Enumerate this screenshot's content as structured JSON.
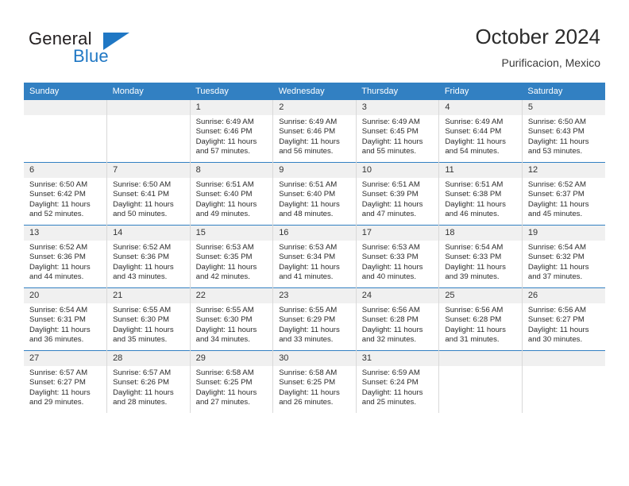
{
  "logo": {
    "word_one": "General",
    "word_two": "Blue",
    "triangle_color": "#1f77c4"
  },
  "header": {
    "title": "October 2024",
    "subtitle": "Purificacion, Mexico",
    "accent_color": "#3280c2",
    "daynum_band_color": "#f0f0f0"
  },
  "weekdays": [
    "Sunday",
    "Monday",
    "Tuesday",
    "Wednesday",
    "Thursday",
    "Friday",
    "Saturday"
  ],
  "weeks": [
    [
      {
        "day": "",
        "sunrise": "",
        "sunset": "",
        "daylight_line1": "",
        "daylight_line2": "",
        "empty": true
      },
      {
        "day": "",
        "sunrise": "",
        "sunset": "",
        "daylight_line1": "",
        "daylight_line2": "",
        "empty": true
      },
      {
        "day": "1",
        "sunrise": "Sunrise: 6:49 AM",
        "sunset": "Sunset: 6:46 PM",
        "daylight_line1": "Daylight: 11 hours",
        "daylight_line2": "and 57 minutes."
      },
      {
        "day": "2",
        "sunrise": "Sunrise: 6:49 AM",
        "sunset": "Sunset: 6:46 PM",
        "daylight_line1": "Daylight: 11 hours",
        "daylight_line2": "and 56 minutes."
      },
      {
        "day": "3",
        "sunrise": "Sunrise: 6:49 AM",
        "sunset": "Sunset: 6:45 PM",
        "daylight_line1": "Daylight: 11 hours",
        "daylight_line2": "and 55 minutes."
      },
      {
        "day": "4",
        "sunrise": "Sunrise: 6:49 AM",
        "sunset": "Sunset: 6:44 PM",
        "daylight_line1": "Daylight: 11 hours",
        "daylight_line2": "and 54 minutes."
      },
      {
        "day": "5",
        "sunrise": "Sunrise: 6:50 AM",
        "sunset": "Sunset: 6:43 PM",
        "daylight_line1": "Daylight: 11 hours",
        "daylight_line2": "and 53 minutes."
      }
    ],
    [
      {
        "day": "6",
        "sunrise": "Sunrise: 6:50 AM",
        "sunset": "Sunset: 6:42 PM",
        "daylight_line1": "Daylight: 11 hours",
        "daylight_line2": "and 52 minutes."
      },
      {
        "day": "7",
        "sunrise": "Sunrise: 6:50 AM",
        "sunset": "Sunset: 6:41 PM",
        "daylight_line1": "Daylight: 11 hours",
        "daylight_line2": "and 50 minutes."
      },
      {
        "day": "8",
        "sunrise": "Sunrise: 6:51 AM",
        "sunset": "Sunset: 6:40 PM",
        "daylight_line1": "Daylight: 11 hours",
        "daylight_line2": "and 49 minutes."
      },
      {
        "day": "9",
        "sunrise": "Sunrise: 6:51 AM",
        "sunset": "Sunset: 6:40 PM",
        "daylight_line1": "Daylight: 11 hours",
        "daylight_line2": "and 48 minutes."
      },
      {
        "day": "10",
        "sunrise": "Sunrise: 6:51 AM",
        "sunset": "Sunset: 6:39 PM",
        "daylight_line1": "Daylight: 11 hours",
        "daylight_line2": "and 47 minutes."
      },
      {
        "day": "11",
        "sunrise": "Sunrise: 6:51 AM",
        "sunset": "Sunset: 6:38 PM",
        "daylight_line1": "Daylight: 11 hours",
        "daylight_line2": "and 46 minutes."
      },
      {
        "day": "12",
        "sunrise": "Sunrise: 6:52 AM",
        "sunset": "Sunset: 6:37 PM",
        "daylight_line1": "Daylight: 11 hours",
        "daylight_line2": "and 45 minutes."
      }
    ],
    [
      {
        "day": "13",
        "sunrise": "Sunrise: 6:52 AM",
        "sunset": "Sunset: 6:36 PM",
        "daylight_line1": "Daylight: 11 hours",
        "daylight_line2": "and 44 minutes."
      },
      {
        "day": "14",
        "sunrise": "Sunrise: 6:52 AM",
        "sunset": "Sunset: 6:36 PM",
        "daylight_line1": "Daylight: 11 hours",
        "daylight_line2": "and 43 minutes."
      },
      {
        "day": "15",
        "sunrise": "Sunrise: 6:53 AM",
        "sunset": "Sunset: 6:35 PM",
        "daylight_line1": "Daylight: 11 hours",
        "daylight_line2": "and 42 minutes."
      },
      {
        "day": "16",
        "sunrise": "Sunrise: 6:53 AM",
        "sunset": "Sunset: 6:34 PM",
        "daylight_line1": "Daylight: 11 hours",
        "daylight_line2": "and 41 minutes."
      },
      {
        "day": "17",
        "sunrise": "Sunrise: 6:53 AM",
        "sunset": "Sunset: 6:33 PM",
        "daylight_line1": "Daylight: 11 hours",
        "daylight_line2": "and 40 minutes."
      },
      {
        "day": "18",
        "sunrise": "Sunrise: 6:54 AM",
        "sunset": "Sunset: 6:33 PM",
        "daylight_line1": "Daylight: 11 hours",
        "daylight_line2": "and 39 minutes."
      },
      {
        "day": "19",
        "sunrise": "Sunrise: 6:54 AM",
        "sunset": "Sunset: 6:32 PM",
        "daylight_line1": "Daylight: 11 hours",
        "daylight_line2": "and 37 minutes."
      }
    ],
    [
      {
        "day": "20",
        "sunrise": "Sunrise: 6:54 AM",
        "sunset": "Sunset: 6:31 PM",
        "daylight_line1": "Daylight: 11 hours",
        "daylight_line2": "and 36 minutes."
      },
      {
        "day": "21",
        "sunrise": "Sunrise: 6:55 AM",
        "sunset": "Sunset: 6:30 PM",
        "daylight_line1": "Daylight: 11 hours",
        "daylight_line2": "and 35 minutes."
      },
      {
        "day": "22",
        "sunrise": "Sunrise: 6:55 AM",
        "sunset": "Sunset: 6:30 PM",
        "daylight_line1": "Daylight: 11 hours",
        "daylight_line2": "and 34 minutes."
      },
      {
        "day": "23",
        "sunrise": "Sunrise: 6:55 AM",
        "sunset": "Sunset: 6:29 PM",
        "daylight_line1": "Daylight: 11 hours",
        "daylight_line2": "and 33 minutes."
      },
      {
        "day": "24",
        "sunrise": "Sunrise: 6:56 AM",
        "sunset": "Sunset: 6:28 PM",
        "daylight_line1": "Daylight: 11 hours",
        "daylight_line2": "and 32 minutes."
      },
      {
        "day": "25",
        "sunrise": "Sunrise: 6:56 AM",
        "sunset": "Sunset: 6:28 PM",
        "daylight_line1": "Daylight: 11 hours",
        "daylight_line2": "and 31 minutes."
      },
      {
        "day": "26",
        "sunrise": "Sunrise: 6:56 AM",
        "sunset": "Sunset: 6:27 PM",
        "daylight_line1": "Daylight: 11 hours",
        "daylight_line2": "and 30 minutes."
      }
    ],
    [
      {
        "day": "27",
        "sunrise": "Sunrise: 6:57 AM",
        "sunset": "Sunset: 6:27 PM",
        "daylight_line1": "Daylight: 11 hours",
        "daylight_line2": "and 29 minutes."
      },
      {
        "day": "28",
        "sunrise": "Sunrise: 6:57 AM",
        "sunset": "Sunset: 6:26 PM",
        "daylight_line1": "Daylight: 11 hours",
        "daylight_line2": "and 28 minutes."
      },
      {
        "day": "29",
        "sunrise": "Sunrise: 6:58 AM",
        "sunset": "Sunset: 6:25 PM",
        "daylight_line1": "Daylight: 11 hours",
        "daylight_line2": "and 27 minutes."
      },
      {
        "day": "30",
        "sunrise": "Sunrise: 6:58 AM",
        "sunset": "Sunset: 6:25 PM",
        "daylight_line1": "Daylight: 11 hours",
        "daylight_line2": "and 26 minutes."
      },
      {
        "day": "31",
        "sunrise": "Sunrise: 6:59 AM",
        "sunset": "Sunset: 6:24 PM",
        "daylight_line1": "Daylight: 11 hours",
        "daylight_line2": "and 25 minutes."
      },
      {
        "day": "",
        "sunrise": "",
        "sunset": "",
        "daylight_line1": "",
        "daylight_line2": "",
        "empty": true
      },
      {
        "day": "",
        "sunrise": "",
        "sunset": "",
        "daylight_line1": "",
        "daylight_line2": "",
        "empty": true
      }
    ]
  ]
}
